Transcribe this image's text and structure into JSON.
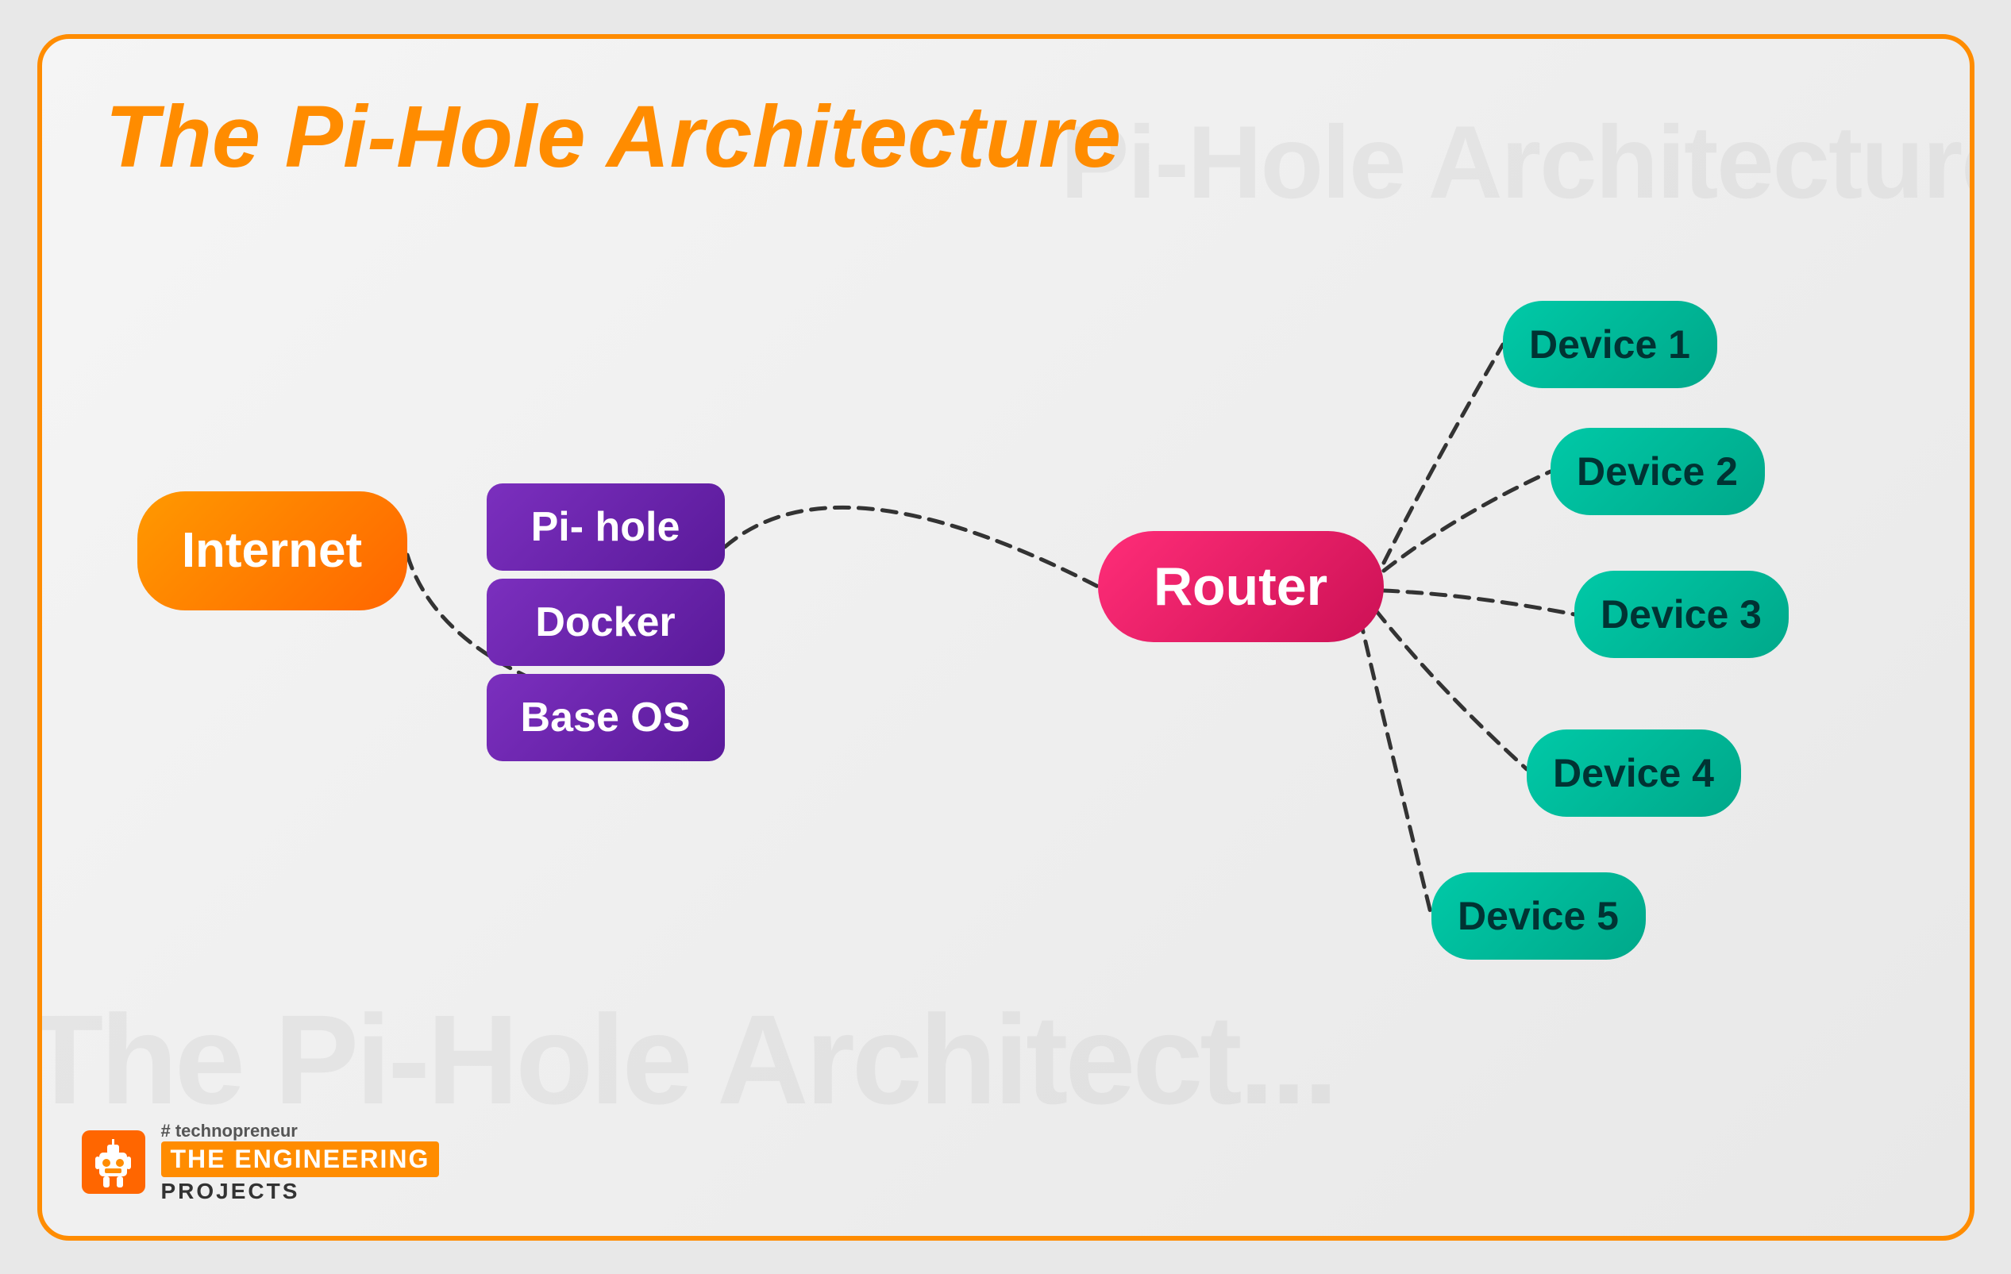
{
  "title": "The Pi-Hole Architecture",
  "watermark_top": "Pi-Hole Architecture",
  "watermark_bottom": "The Pi-Hole Architect...",
  "nodes": {
    "internet": {
      "label": "Internet"
    },
    "pi_hole": {
      "label": "Pi- hole"
    },
    "docker": {
      "label": "Docker"
    },
    "base_os": {
      "label": "Base OS"
    },
    "router": {
      "label": "Router"
    },
    "device1": {
      "label": "Device 1"
    },
    "device2": {
      "label": "Device 2"
    },
    "device3": {
      "label": "Device 3"
    },
    "device4": {
      "label": "Device 4"
    },
    "device5": {
      "label": "Device 5"
    }
  },
  "branding": {
    "hashtag": "# technopreneur",
    "name": "THE ENGINEERING",
    "projects": "PROJECTS"
  },
  "colors": {
    "orange": "#ff8c00",
    "internet_bg": "#ff8000",
    "router_bg": "#ff2d78",
    "device_bg": "#00c9a7",
    "stack_bg": "#6b21a8",
    "border": "#ff8c00"
  }
}
